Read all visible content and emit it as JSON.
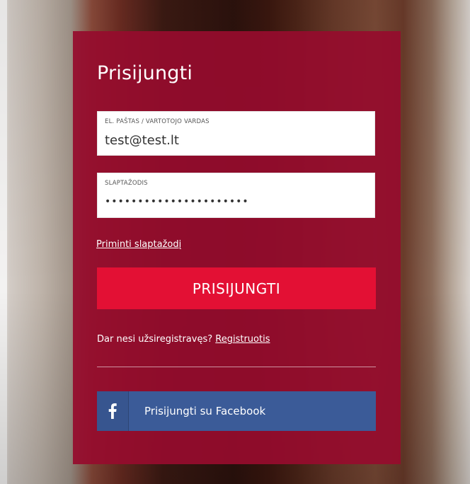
{
  "login": {
    "title": "Prisijungti",
    "email_label": "EL. PAŠTAS / VARTOTOJO VARDAS",
    "email_value": "test@test.lt",
    "password_label": "SLAPTAŽODIS",
    "password_mask": "••••••••••••••••••••••",
    "remind_password_link": "Priminti slaptažodį",
    "login_button": "PRISIJUNGTI",
    "register_prompt": "Dar nesi užsiregistravęs?",
    "register_link": "Registruotis",
    "facebook_button": "Prisijungti su Facebook",
    "facebook_icon": "facebook-icon"
  },
  "colors": {
    "panel": "#960c2d",
    "login_button": "#e31034",
    "facebook_button": "#3b5b98",
    "text": "#ffffff"
  }
}
